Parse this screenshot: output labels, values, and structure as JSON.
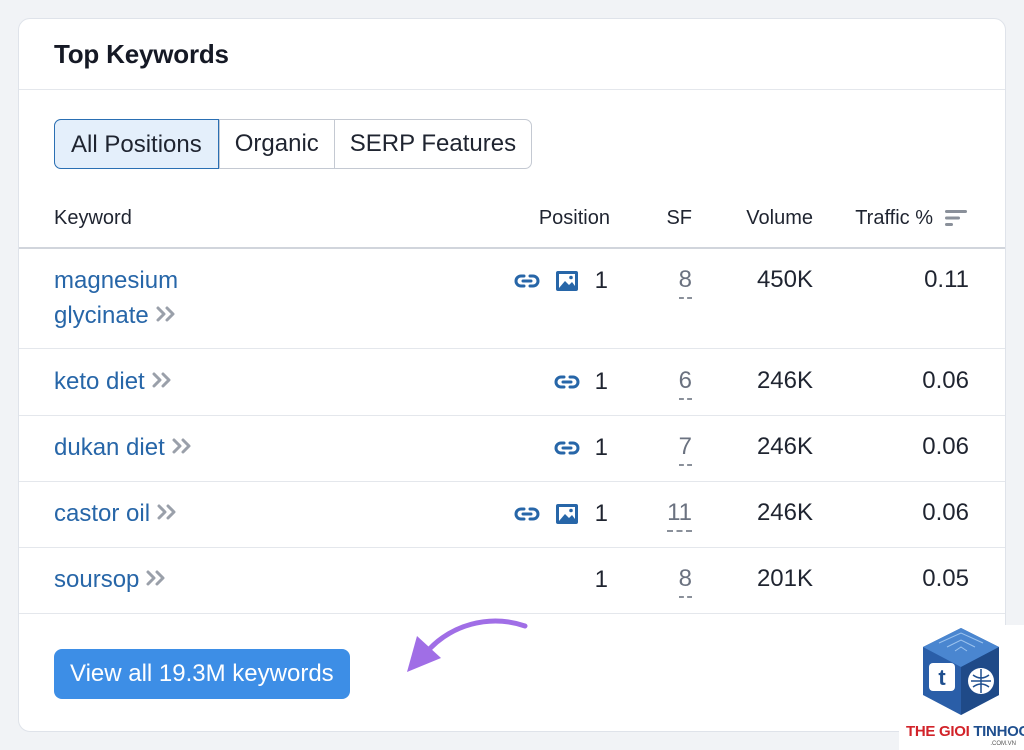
{
  "card": {
    "title": "Top Keywords"
  },
  "tabs": [
    {
      "label": "All Positions",
      "active": true
    },
    {
      "label": "Organic",
      "active": false
    },
    {
      "label": "SERP Features",
      "active": false
    }
  ],
  "columns": {
    "keyword": "Keyword",
    "position": "Position",
    "sf": "SF",
    "volume": "Volume",
    "traffic": "Traffic %"
  },
  "rows": [
    {
      "keyword": "magnesium glycinate",
      "icons": [
        "link-icon",
        "image-icon"
      ],
      "position": "1",
      "sf": "8",
      "volume": "450K",
      "traffic": "0.11"
    },
    {
      "keyword": "keto diet",
      "icons": [
        "link-icon"
      ],
      "position": "1",
      "sf": "6",
      "volume": "246K",
      "traffic": "0.06"
    },
    {
      "keyword": "dukan diet",
      "icons": [
        "link-icon"
      ],
      "position": "1",
      "sf": "7",
      "volume": "246K",
      "traffic": "0.06"
    },
    {
      "keyword": "castor oil",
      "icons": [
        "link-icon",
        "image-icon"
      ],
      "position": "1",
      "sf": "11",
      "volume": "246K",
      "traffic": "0.06"
    },
    {
      "keyword": "soursop",
      "icons": [],
      "position": "1",
      "sf": "8",
      "volume": "201K",
      "traffic": "0.05"
    }
  ],
  "view_all_button": {
    "label": "View all 19.3M keywords"
  },
  "watermark": {
    "brand_red": "THE GIOI",
    "brand_blue": "TINHOC",
    "domain": ".COM.VN"
  },
  "colors": {
    "link": "#2766a8",
    "button": "#3d8ee6",
    "active_tab_bg": "#e4effb",
    "arrow": "#a06ee6"
  }
}
